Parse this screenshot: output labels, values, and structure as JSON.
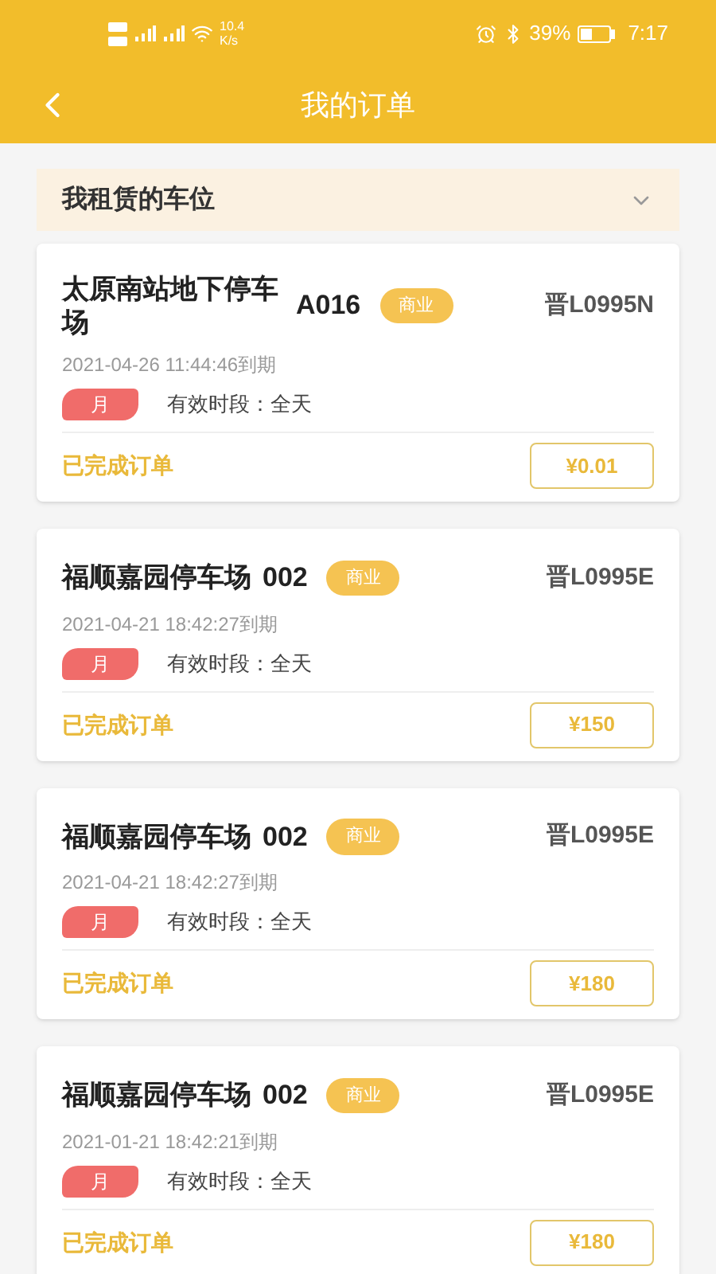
{
  "status_bar": {
    "speed": "10.4",
    "speed_unit": "K/s",
    "battery": "39%",
    "time": "7:17"
  },
  "header": {
    "title": "我的订单"
  },
  "section": {
    "title": "我租赁的车位",
    "expanded": false
  },
  "orders": [
    {
      "name": "太原南站地下停车场",
      "code": "A016",
      "tag": "商业",
      "plate": "晋L0995N",
      "expiry": "2021-04-26 11:44:46到期",
      "period": "月",
      "hours": "有效时段：全天",
      "status": "已完成订单",
      "price": "¥0.01"
    },
    {
      "name": "福顺嘉园停车场",
      "code": "002",
      "tag": "商业",
      "plate": "晋L0995E",
      "expiry": "2021-04-21 18:42:27到期",
      "period": "月",
      "hours": "有效时段：全天",
      "status": "已完成订单",
      "price": "¥150"
    },
    {
      "name": "福顺嘉园停车场",
      "code": "002",
      "tag": "商业",
      "plate": "晋L0995E",
      "expiry": "2021-04-21 18:42:27到期",
      "period": "月",
      "hours": "有效时段：全天",
      "status": "已完成订单",
      "price": "¥180"
    },
    {
      "name": "福顺嘉园停车场",
      "code": "002",
      "tag": "商业",
      "plate": "晋L0995E",
      "expiry": "2021-01-21 18:42:21到期",
      "period": "月",
      "hours": "有效时段：全天",
      "status": "已完成订单",
      "price": "¥180"
    }
  ]
}
